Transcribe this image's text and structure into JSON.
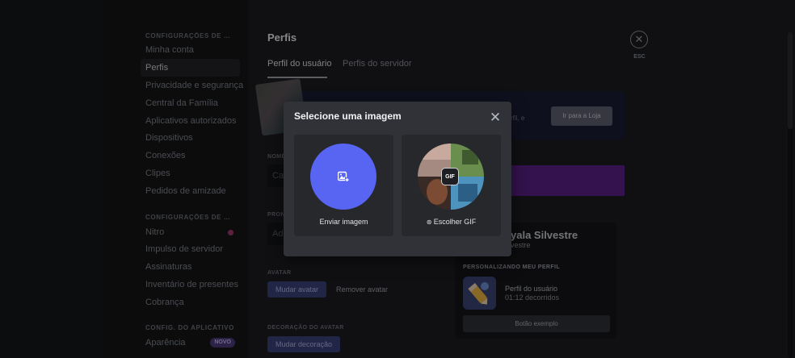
{
  "sidebar": {
    "user_settings_header": "CONFIGURAÇÕES DE USUÁRIO",
    "user_items": [
      {
        "label": "Minha conta"
      },
      {
        "label": "Perfis",
        "active": true
      },
      {
        "label": "Privacidade e segurança"
      },
      {
        "label": "Central da Família"
      },
      {
        "label": "Aplicativos autorizados"
      },
      {
        "label": "Dispositivos"
      },
      {
        "label": "Conexões"
      },
      {
        "label": "Clipes"
      },
      {
        "label": "Pedidos de amizade"
      }
    ],
    "billing_header": "CONFIGURAÇÕES DE COBRANÇA",
    "billing_items": [
      {
        "label": "Nitro"
      },
      {
        "label": "Impulso de servidor"
      },
      {
        "label": "Assinaturas"
      },
      {
        "label": "Inventário de presentes"
      },
      {
        "label": "Cobrança"
      }
    ],
    "app_header": "CONFIG. DO APLICATIVO",
    "app_items": [
      {
        "label": "Aparência",
        "badge": "NOVO"
      }
    ]
  },
  "main": {
    "title": "Perfis",
    "tabs": [
      {
        "label": "Perfil do usuário",
        "active": true
      },
      {
        "label": "Perfis do servidor"
      }
    ],
    "esc_label": "ESC",
    "banner_text": "de perfil, e",
    "shop_button": "Ir para a Loja",
    "name_label": "NOME",
    "name_value": "Ca",
    "pronouns_label": "PRONOMES",
    "pronouns_value": "Ad",
    "avatar_label": "AVATAR",
    "change_avatar": "Mudar avatar",
    "remove_avatar": "Remover avatar",
    "decoration_label": "DECORAÇÃO DO AVATAR",
    "change_decoration": "Mudar decoração"
  },
  "preview": {
    "name": "yala Silvestre",
    "username": "lvestre",
    "section_header": "PERSONALIZANDO MEU PERFIL",
    "activity_title": "Perfil do usuário",
    "activity_elapsed": "01:12 decorridos",
    "example_button": "Botão exemplo"
  },
  "modal": {
    "title": "Selecione uma imagem",
    "options": [
      {
        "label": "Enviar imagem",
        "icon": "image-plus-icon"
      },
      {
        "label": "Escolher GIF",
        "icon": "gif-icon",
        "badge": "GIF"
      }
    ]
  },
  "colors": {
    "accent": "#5865f2",
    "nitro_purple": "#5b1f86",
    "modal_bg": "#303237"
  }
}
